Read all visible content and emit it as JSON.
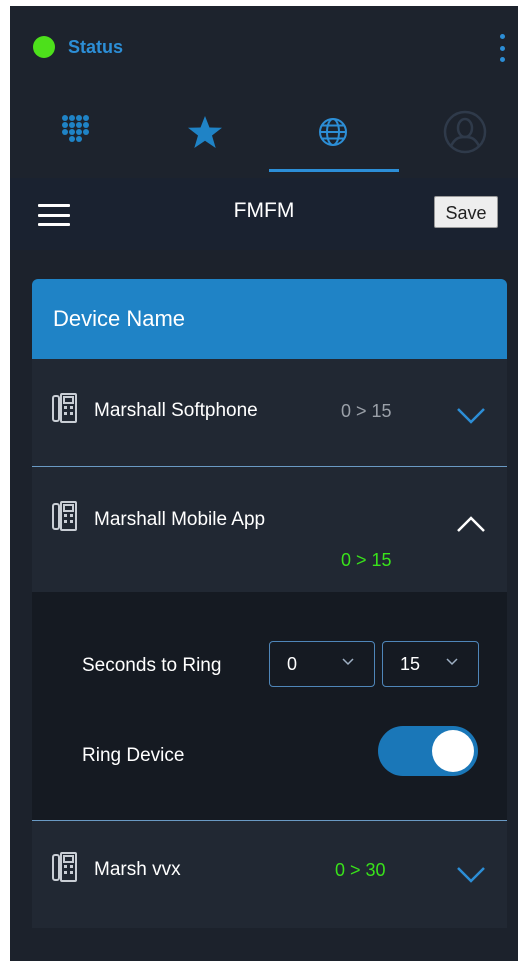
{
  "status": {
    "label": "Status",
    "color": "#4de01b"
  },
  "tabs": [
    {
      "icon": "dialpad-icon",
      "active": false
    },
    {
      "icon": "star-icon",
      "active": false
    },
    {
      "icon": "globe-icon",
      "active": true
    },
    {
      "icon": "contact-icon",
      "active": false
    }
  ],
  "header": {
    "title": "FMFM",
    "save_label": "Save"
  },
  "card": {
    "heading": "Device Name"
  },
  "devices": [
    {
      "name": "Marshall Softphone",
      "range": "0 > 15",
      "expanded": false
    },
    {
      "name": "Marshall Mobile App",
      "range": "0 > 15",
      "expanded": true
    },
    {
      "name": "Marsh vvx",
      "range": "0 > 30",
      "expanded": false
    }
  ],
  "expanded_panel": {
    "seconds_label": "Seconds to Ring",
    "start_value": "0",
    "end_value": "15",
    "ring_label": "Ring Device",
    "ring_enabled": true
  },
  "colors": {
    "accent": "#2c8ed6",
    "range_active": "#39e21b",
    "range_inactive": "#9aa0a8",
    "background": "#1c222c"
  }
}
